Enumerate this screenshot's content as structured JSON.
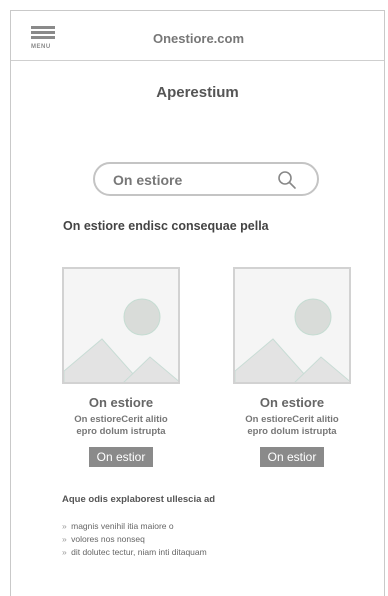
{
  "header": {
    "menu_label": "MENU",
    "site_name": "Onestiore.com"
  },
  "page": {
    "title": "Aperestium"
  },
  "search": {
    "placeholder": "On estiore",
    "icon": "search-icon"
  },
  "section": {
    "heading": "On estiore endisc consequae pella"
  },
  "cards": [
    {
      "title": "On estiore",
      "desc_line1": "On estioreCerit alitio",
      "desc_line2": "epro dolum istrupta",
      "button": "On estior"
    },
    {
      "title": "On estiore",
      "desc_line1": "On estioreCerit alitio",
      "desc_line2": "epro dolum istrupta",
      "button": "On estior"
    }
  ],
  "list": {
    "heading": "Aque odis explaborest ullescia ad",
    "bullet": "»",
    "items": [
      "magnis venihil itia maiore o",
      "volores nos nonseq",
      "dit dolutec tectur, niam inti ditaquam"
    ]
  },
  "colors": {
    "placeholder_bg": "#f5f5f5",
    "circle": "#d8d8d8",
    "mountain": "#e2e2e2",
    "button_bg": "#8a8a8a"
  }
}
